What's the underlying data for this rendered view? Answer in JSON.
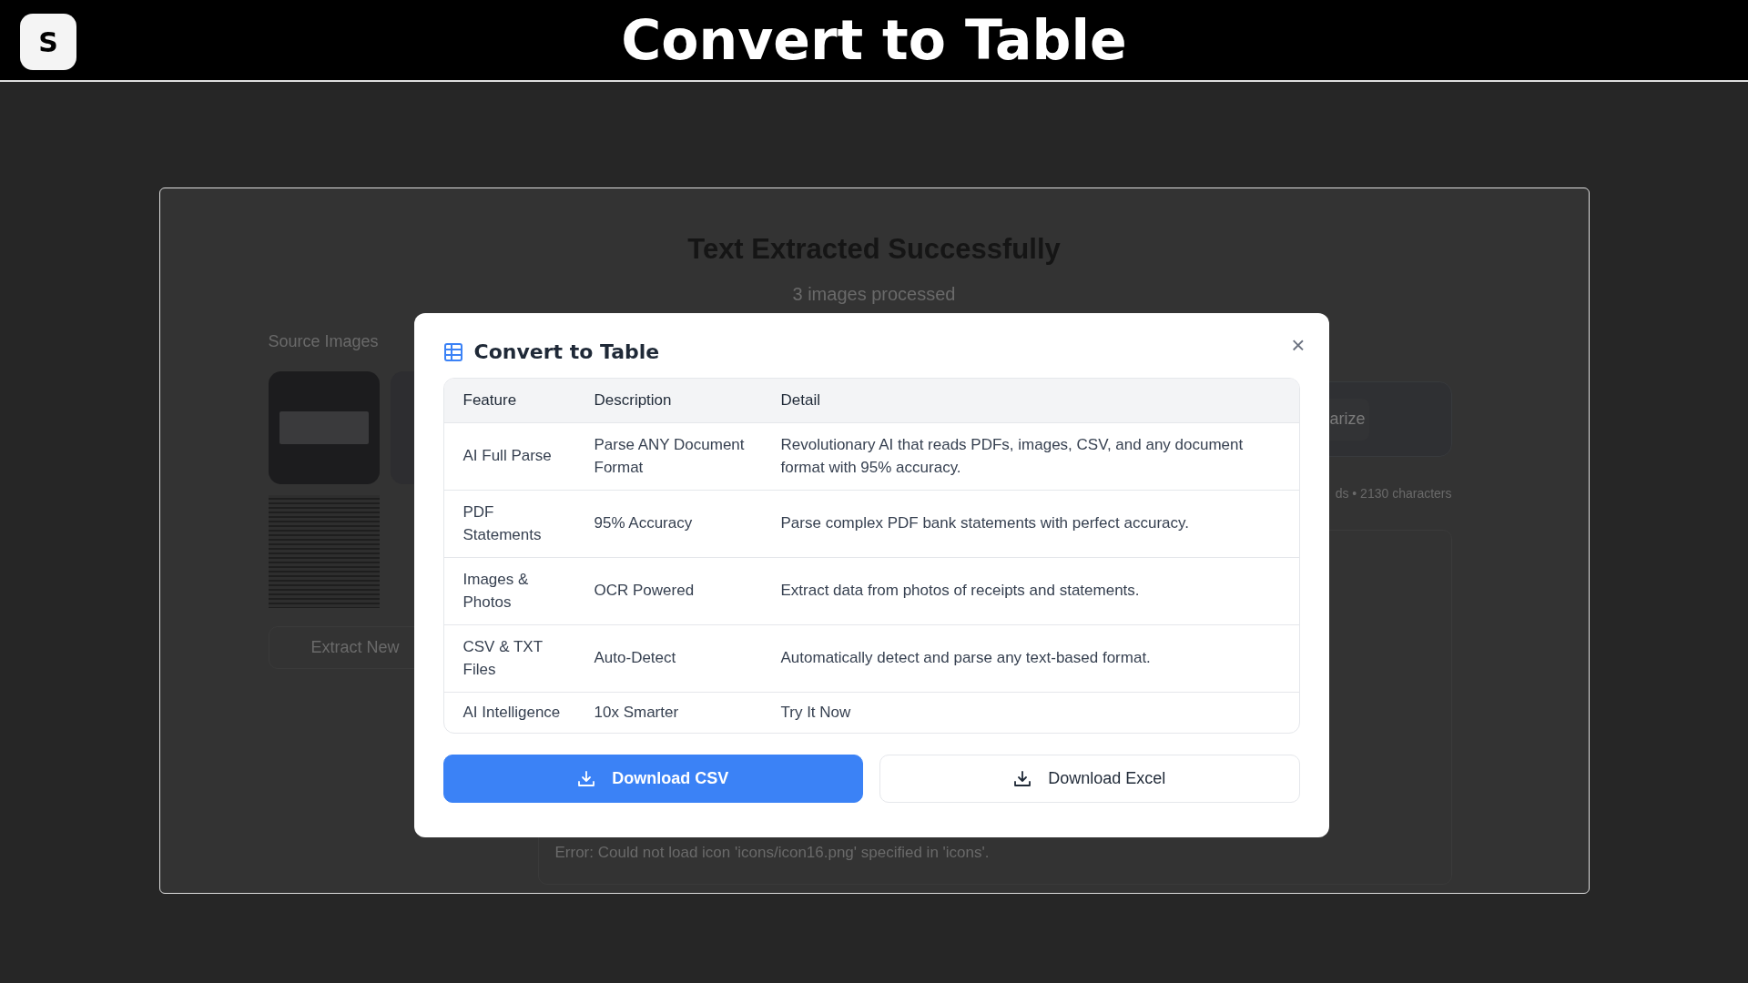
{
  "header": {
    "logo": "S",
    "title": "Convert to Table"
  },
  "background_page": {
    "title": "Text Extracted Successfully",
    "subtitle": "3 images processed",
    "source_images_label": "Source Images",
    "extract_button": "Extract New",
    "action_button": "arize",
    "stats": "ds • 2130 characters",
    "output_lines": [
      "Error: Could not load icon 'icons/icon16.png' specified in 'icons'."
    ]
  },
  "dialog": {
    "title": "Convert to Table",
    "close": "×",
    "columns": [
      "Feature",
      "Description",
      "Detail"
    ],
    "rows": [
      [
        "AI Full Parse",
        "Parse ANY Document Format",
        "Revolutionary AI that reads PDFs, images, CSV, and any document format with 95% accuracy."
      ],
      [
        "PDF Statements",
        "95% Accuracy",
        "Parse complex PDF bank statements with perfect accuracy."
      ],
      [
        "Images & Photos",
        "OCR Powered",
        "Extract data from photos of receipts and statements."
      ],
      [
        "CSV & TXT Files",
        "Auto-Detect",
        "Automatically detect and parse any text-based format."
      ],
      [
        "AI Intelligence",
        "10x Smarter",
        "Try It Now"
      ]
    ],
    "buttons": [
      {
        "label": "Download CSV",
        "primary": true
      },
      {
        "label": "Download Excel",
        "primary": false
      }
    ]
  }
}
